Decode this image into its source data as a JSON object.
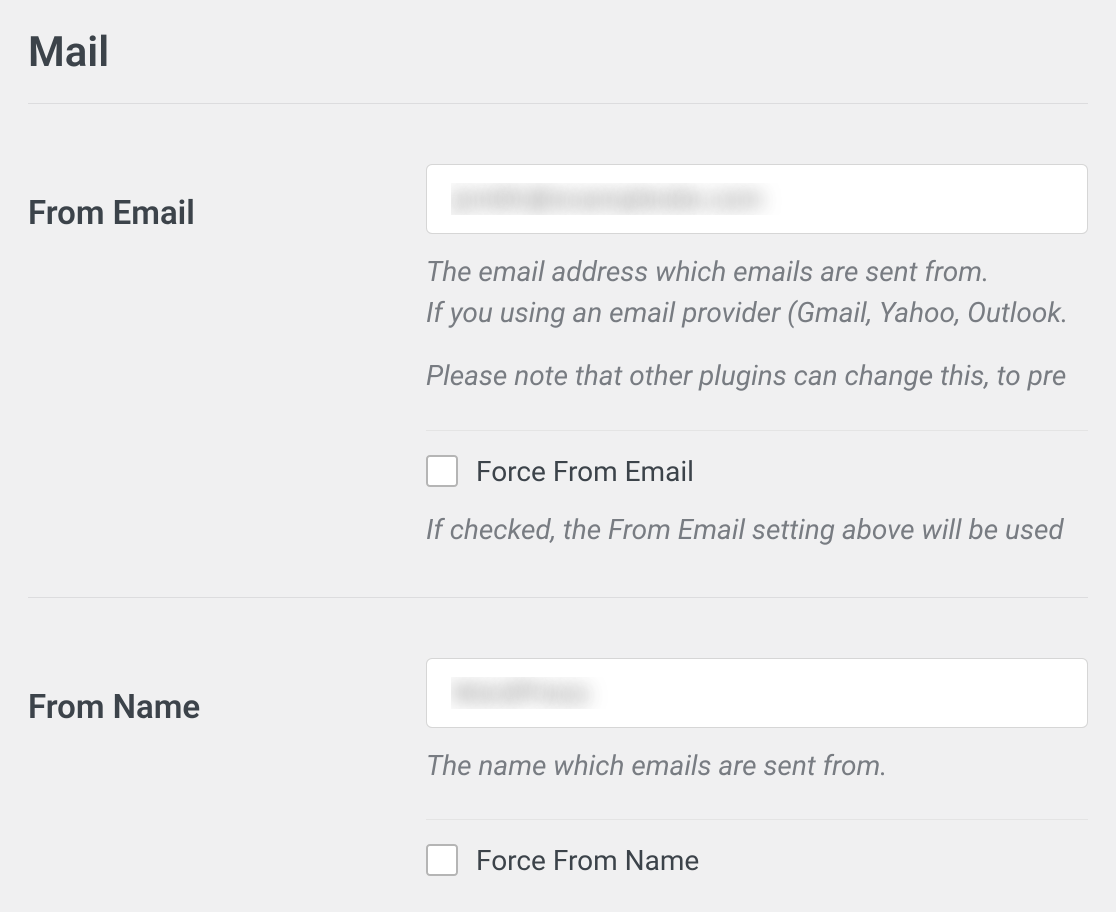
{
  "section": {
    "title": "Mail"
  },
  "fromEmail": {
    "label": "From Email",
    "value": "jsmith@examplesite.com",
    "hint1": "The email address which emails are sent from.",
    "hint2": "If you using an email provider (Gmail, Yahoo, Outlook.",
    "hint3": "Please note that other plugins can change this, to pre",
    "checkboxLabel": "Force From Email",
    "checkboxHint": "If checked, the From Email setting above will be used"
  },
  "fromName": {
    "label": "From Name",
    "value": "WordPress",
    "hint": "The name which emails are sent from.",
    "checkboxLabel": "Force From Name"
  }
}
